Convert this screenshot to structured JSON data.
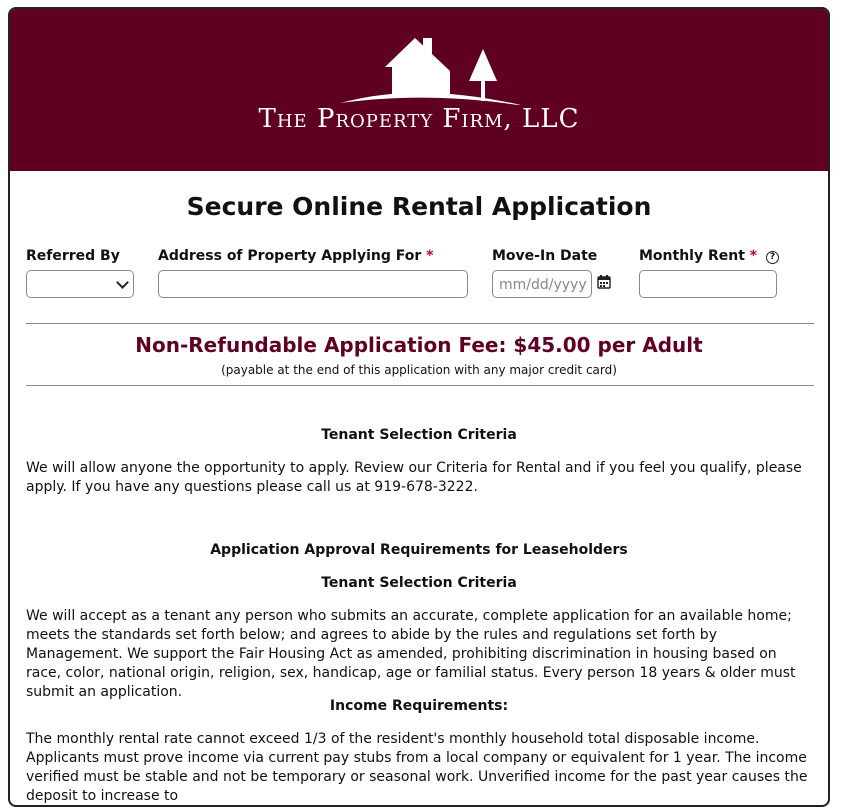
{
  "header": {
    "logo_text": "The Property Firm, LLC",
    "bg_color": "#5f0023"
  },
  "page_title": "Secure Online Rental Application",
  "form": {
    "referred_by": {
      "label": "Referred By",
      "value": ""
    },
    "address": {
      "label": "Address of Property Applying For",
      "required_mark": "*",
      "value": ""
    },
    "move_in": {
      "label": "Move-In Date",
      "placeholder": "mm/dd/yyyy",
      "icon": "calendar-icon"
    },
    "rent": {
      "label": "Monthly Rent",
      "required_mark": "*",
      "help_icon": "?",
      "value": ""
    }
  },
  "fee": {
    "title": "Non-Refundable Application Fee: $45.00 per Adult",
    "subtitle": "(payable at the end of this application with any major credit card)"
  },
  "content": {
    "section1_heading": "Tenant Selection Criteria",
    "section1_text": "We will allow anyone the opportunity to apply.  Review our Criteria for Rental and if you feel you qualify, please apply.  If you have any questions please call us at 919-678-3222.",
    "section2_heading": "Application Approval Requirements for Leaseholders",
    "section2_subheading": "Tenant Selection Criteria",
    "section2_text": "We will accept as a tenant any person who submits an accurate, complete application for an available home; meets the standards set forth below; and agrees to abide by the rules and regulations set forth by Management. We support the Fair Housing Act as amended, prohibiting discrimination in housing based on race, color, national origin, religion, sex, handicap, age or familial status. Every person 18 years & older must submit an application.",
    "income_heading": "Income Requirements:",
    "income_text": "The monthly rental rate cannot exceed 1/3 of the resident's monthly household total disposable income. Applicants must prove income via current pay stubs from a local company or equivalent for 1 year. The income verified must be stable and not be temporary or seasonal work. Unverified income for the past year causes the deposit to increase to"
  }
}
